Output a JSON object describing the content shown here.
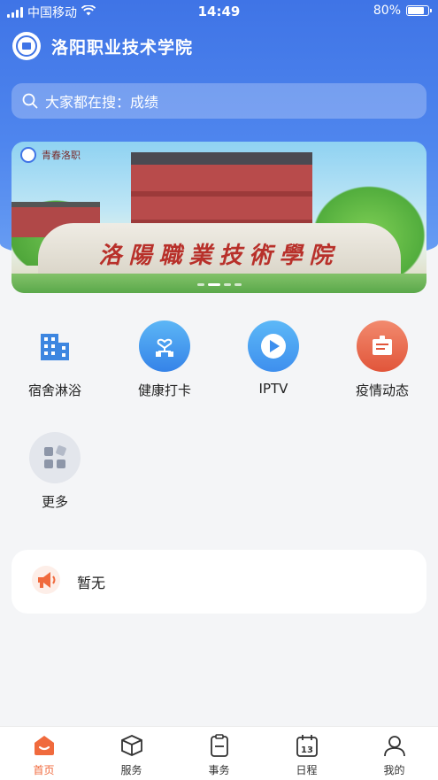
{
  "status_bar": {
    "carrier": "中国移动",
    "time": "14:49",
    "battery": "80%",
    "battery_level": 0.8
  },
  "header": {
    "title": "洛阳职业技术学院"
  },
  "search": {
    "placeholder": "大家都在搜：成绩"
  },
  "banner": {
    "inscription": "洛陽職業技術學院",
    "stamp_text": "青春洛职",
    "page_count": 4,
    "active_page": 1
  },
  "grid": {
    "items": [
      {
        "label": "宿舍淋浴",
        "icon": "building-icon"
      },
      {
        "label": "健康打卡",
        "icon": "health-checkin-icon"
      },
      {
        "label": "IPTV",
        "icon": "play-icon"
      },
      {
        "label": "疫情动态",
        "icon": "epidemic-news-icon"
      },
      {
        "label": "更多",
        "icon": "more-grid-icon"
      }
    ]
  },
  "notice": {
    "text": "暂无",
    "icon": "megaphone-icon"
  },
  "tabbar": {
    "items": [
      {
        "label": "首页",
        "icon": "home-icon",
        "active": true
      },
      {
        "label": "服务",
        "icon": "cube-icon",
        "active": false
      },
      {
        "label": "事务",
        "icon": "clipboard-icon",
        "active": false
      },
      {
        "label": "日程",
        "icon": "calendar-icon",
        "active": false
      },
      {
        "label": "我的",
        "icon": "user-icon",
        "active": false
      }
    ]
  },
  "colors": {
    "primary": "#3f74e6",
    "accent": "#f06a3d",
    "background": "#f4f5f7"
  }
}
